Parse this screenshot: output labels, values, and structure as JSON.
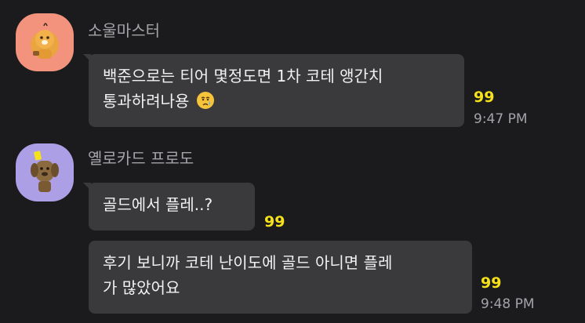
{
  "messages": [
    {
      "sender": "소울마스터",
      "text_line1": "백준으로는 티어 몇정도면 1차 코테 앵간치",
      "text_line2": "통과하려나용",
      "emoji": "crying-face",
      "unread": "99",
      "time": "9:47 PM"
    },
    {
      "sender": "옐로카드 프로도",
      "bubble1": "골드에서 플레..?",
      "bubble1_unread": "99",
      "bubble2_line1": "후기 보니까 코테 난이도에 골드 아니면 플레",
      "bubble2_line2": "가 많았어요",
      "bubble2_unread": "99",
      "bubble2_time": "9:48 PM"
    }
  ],
  "colors": {
    "background": "#1b1b1d",
    "bubble": "#3a3a3c",
    "unread": "#f6e21a",
    "avatar1": "#f4937d",
    "avatar2": "#ad9fe6"
  }
}
